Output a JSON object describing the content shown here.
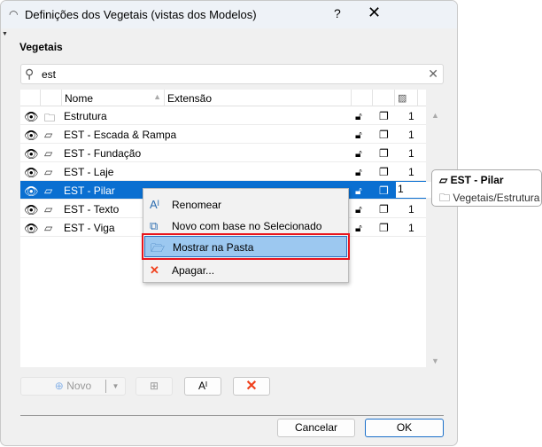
{
  "window": {
    "title": "Definições dos Vegetais (vistas dos Modelos)",
    "help": "?",
    "close": "✕"
  },
  "section_label": "Vegetais",
  "search": {
    "value": "est"
  },
  "columns": {
    "name": "Nome",
    "extension": "Extensão"
  },
  "rows": [
    {
      "type": "folder",
      "name": "Estrutura",
      "value": "1"
    },
    {
      "type": "layer",
      "name": "EST - Escada & Rampa",
      "value": "1"
    },
    {
      "type": "layer",
      "name": "EST - Fundação",
      "value": "1"
    },
    {
      "type": "layer",
      "name": "EST - Laje",
      "value": "1"
    },
    {
      "type": "layer",
      "name": "EST - Pilar",
      "value": "1",
      "selected": true
    },
    {
      "type": "layer",
      "name": "EST - Texto",
      "value": "1"
    },
    {
      "type": "layer",
      "name": "EST - Viga",
      "value": "1"
    }
  ],
  "context_menu": [
    {
      "label": "Renomear",
      "icon": "rename-icon"
    },
    {
      "label": "Novo com base no Selecionado",
      "icon": "new-from-selected-icon"
    },
    {
      "label": "Mostrar na Pasta",
      "icon": "show-in-folder-icon",
      "highlighted": true
    },
    {
      "label": "Apagar...",
      "icon": "delete-icon"
    }
  ],
  "tooltip": {
    "name": "EST - Pilar",
    "path": "Vegetais/Estrutura"
  },
  "toolbar": {
    "new_label": "Novo"
  },
  "footer": {
    "cancel": "Cancelar",
    "ok": "OK"
  },
  "colors": {
    "selection": "#0a6fd1",
    "highlight_border": "#e8141c",
    "delete": "#f0401c"
  }
}
